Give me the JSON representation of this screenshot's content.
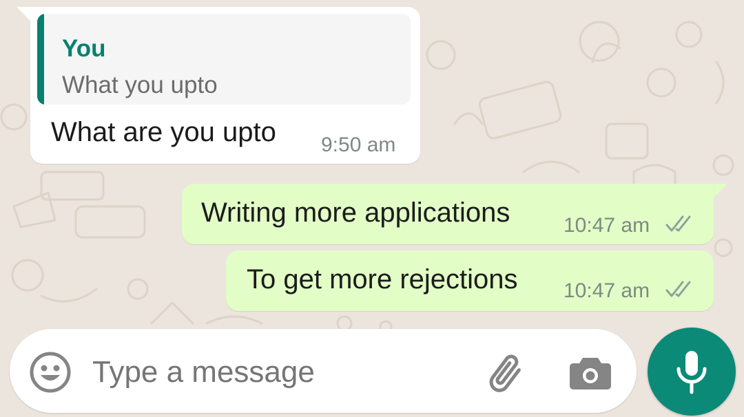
{
  "chat": {
    "messages": [
      {
        "direction": "incoming",
        "quoted": {
          "author": "You",
          "text": "What you upto"
        },
        "text": "What are you upto",
        "time": "9:50 am"
      },
      {
        "direction": "outgoing",
        "text": "Writing more applications",
        "time": "10:47 am",
        "status_icon": "double-check-icon"
      },
      {
        "direction": "outgoing",
        "text": "To get more rejections",
        "time": "10:47 am",
        "status_icon": "double-check-icon"
      }
    ]
  },
  "composer": {
    "placeholder": "Type a message",
    "emoji_icon": "emoji-icon",
    "attach_icon": "paperclip-icon",
    "camera_icon": "camera-icon",
    "mic_icon": "microphone-icon"
  },
  "colors": {
    "background": "#ece5dd",
    "incoming_bubble": "#ffffff",
    "outgoing_bubble": "#e2fdc6",
    "accent": "#06806f",
    "mic_button": "#0b8a78"
  }
}
